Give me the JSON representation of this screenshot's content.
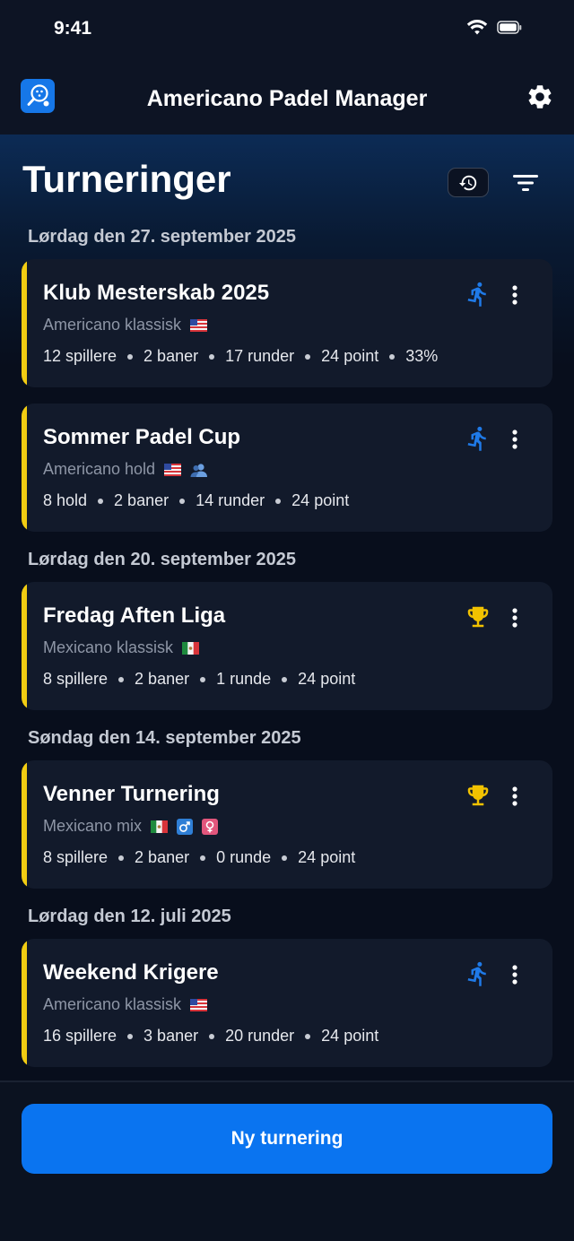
{
  "status_bar": {
    "time": "9:41",
    "wifi_icon": "wifi-icon",
    "battery_icon": "battery-icon"
  },
  "header": {
    "title": "Americano Padel Manager",
    "logo_icon": "padel-racket-icon",
    "settings_icon": "gear-icon"
  },
  "page": {
    "title": "Turneringer",
    "history_icon": "history-icon",
    "filter_icon": "filter-icon"
  },
  "groups": [
    {
      "date": "Lørdag den 27. september 2025"
    },
    {
      "date": "Lørdag den 20. september 2025"
    },
    {
      "date": "Søndag den 14. september 2025"
    },
    {
      "date": "Lørdag den 12. juli 2025"
    }
  ],
  "tournaments": [
    {
      "name": "Klub Mesterskab 2025",
      "type": "Americano klassisk",
      "flags": [
        "us-flag-icon"
      ],
      "stats": [
        "12 spillere",
        "2 baner",
        "17 runder",
        "24 point",
        "33%"
      ],
      "status": "running-icon"
    },
    {
      "name": "Sommer Padel Cup",
      "type": "Americano hold",
      "flags": [
        "us-flag-icon",
        "team-icon"
      ],
      "stats": [
        "8 hold",
        "2 baner",
        "14 runder",
        "24 point"
      ],
      "status": "running-icon"
    },
    {
      "name": "Fredag Aften Liga",
      "type": "Mexicano klassisk",
      "flags": [
        "mx-flag-icon"
      ],
      "stats": [
        "8 spillere",
        "2 baner",
        "1 runde",
        "24 point"
      ],
      "status": "trophy-icon"
    },
    {
      "name": "Venner Turnering",
      "type": "Mexicano mix",
      "flags": [
        "mx-flag-icon",
        "male-icon",
        "female-icon"
      ],
      "stats": [
        "8 spillere",
        "2 baner",
        "0 runde",
        "24 point"
      ],
      "status": "trophy-icon"
    },
    {
      "name": "Weekend Krigere",
      "type": "Americano klassisk",
      "flags": [
        "us-flag-icon"
      ],
      "stats": [
        "16 spillere",
        "3 baner",
        "20 runder",
        "24 point"
      ],
      "status": "running-icon"
    }
  ],
  "footer": {
    "new_button_label": "Ny turnering"
  },
  "colors": {
    "accent_yellow": "#f2cc12",
    "primary_blue": "#0a74f0",
    "card_bg": "#121a2b",
    "running_blue": "#1f7ae8",
    "trophy_gold": "#f2c200"
  }
}
